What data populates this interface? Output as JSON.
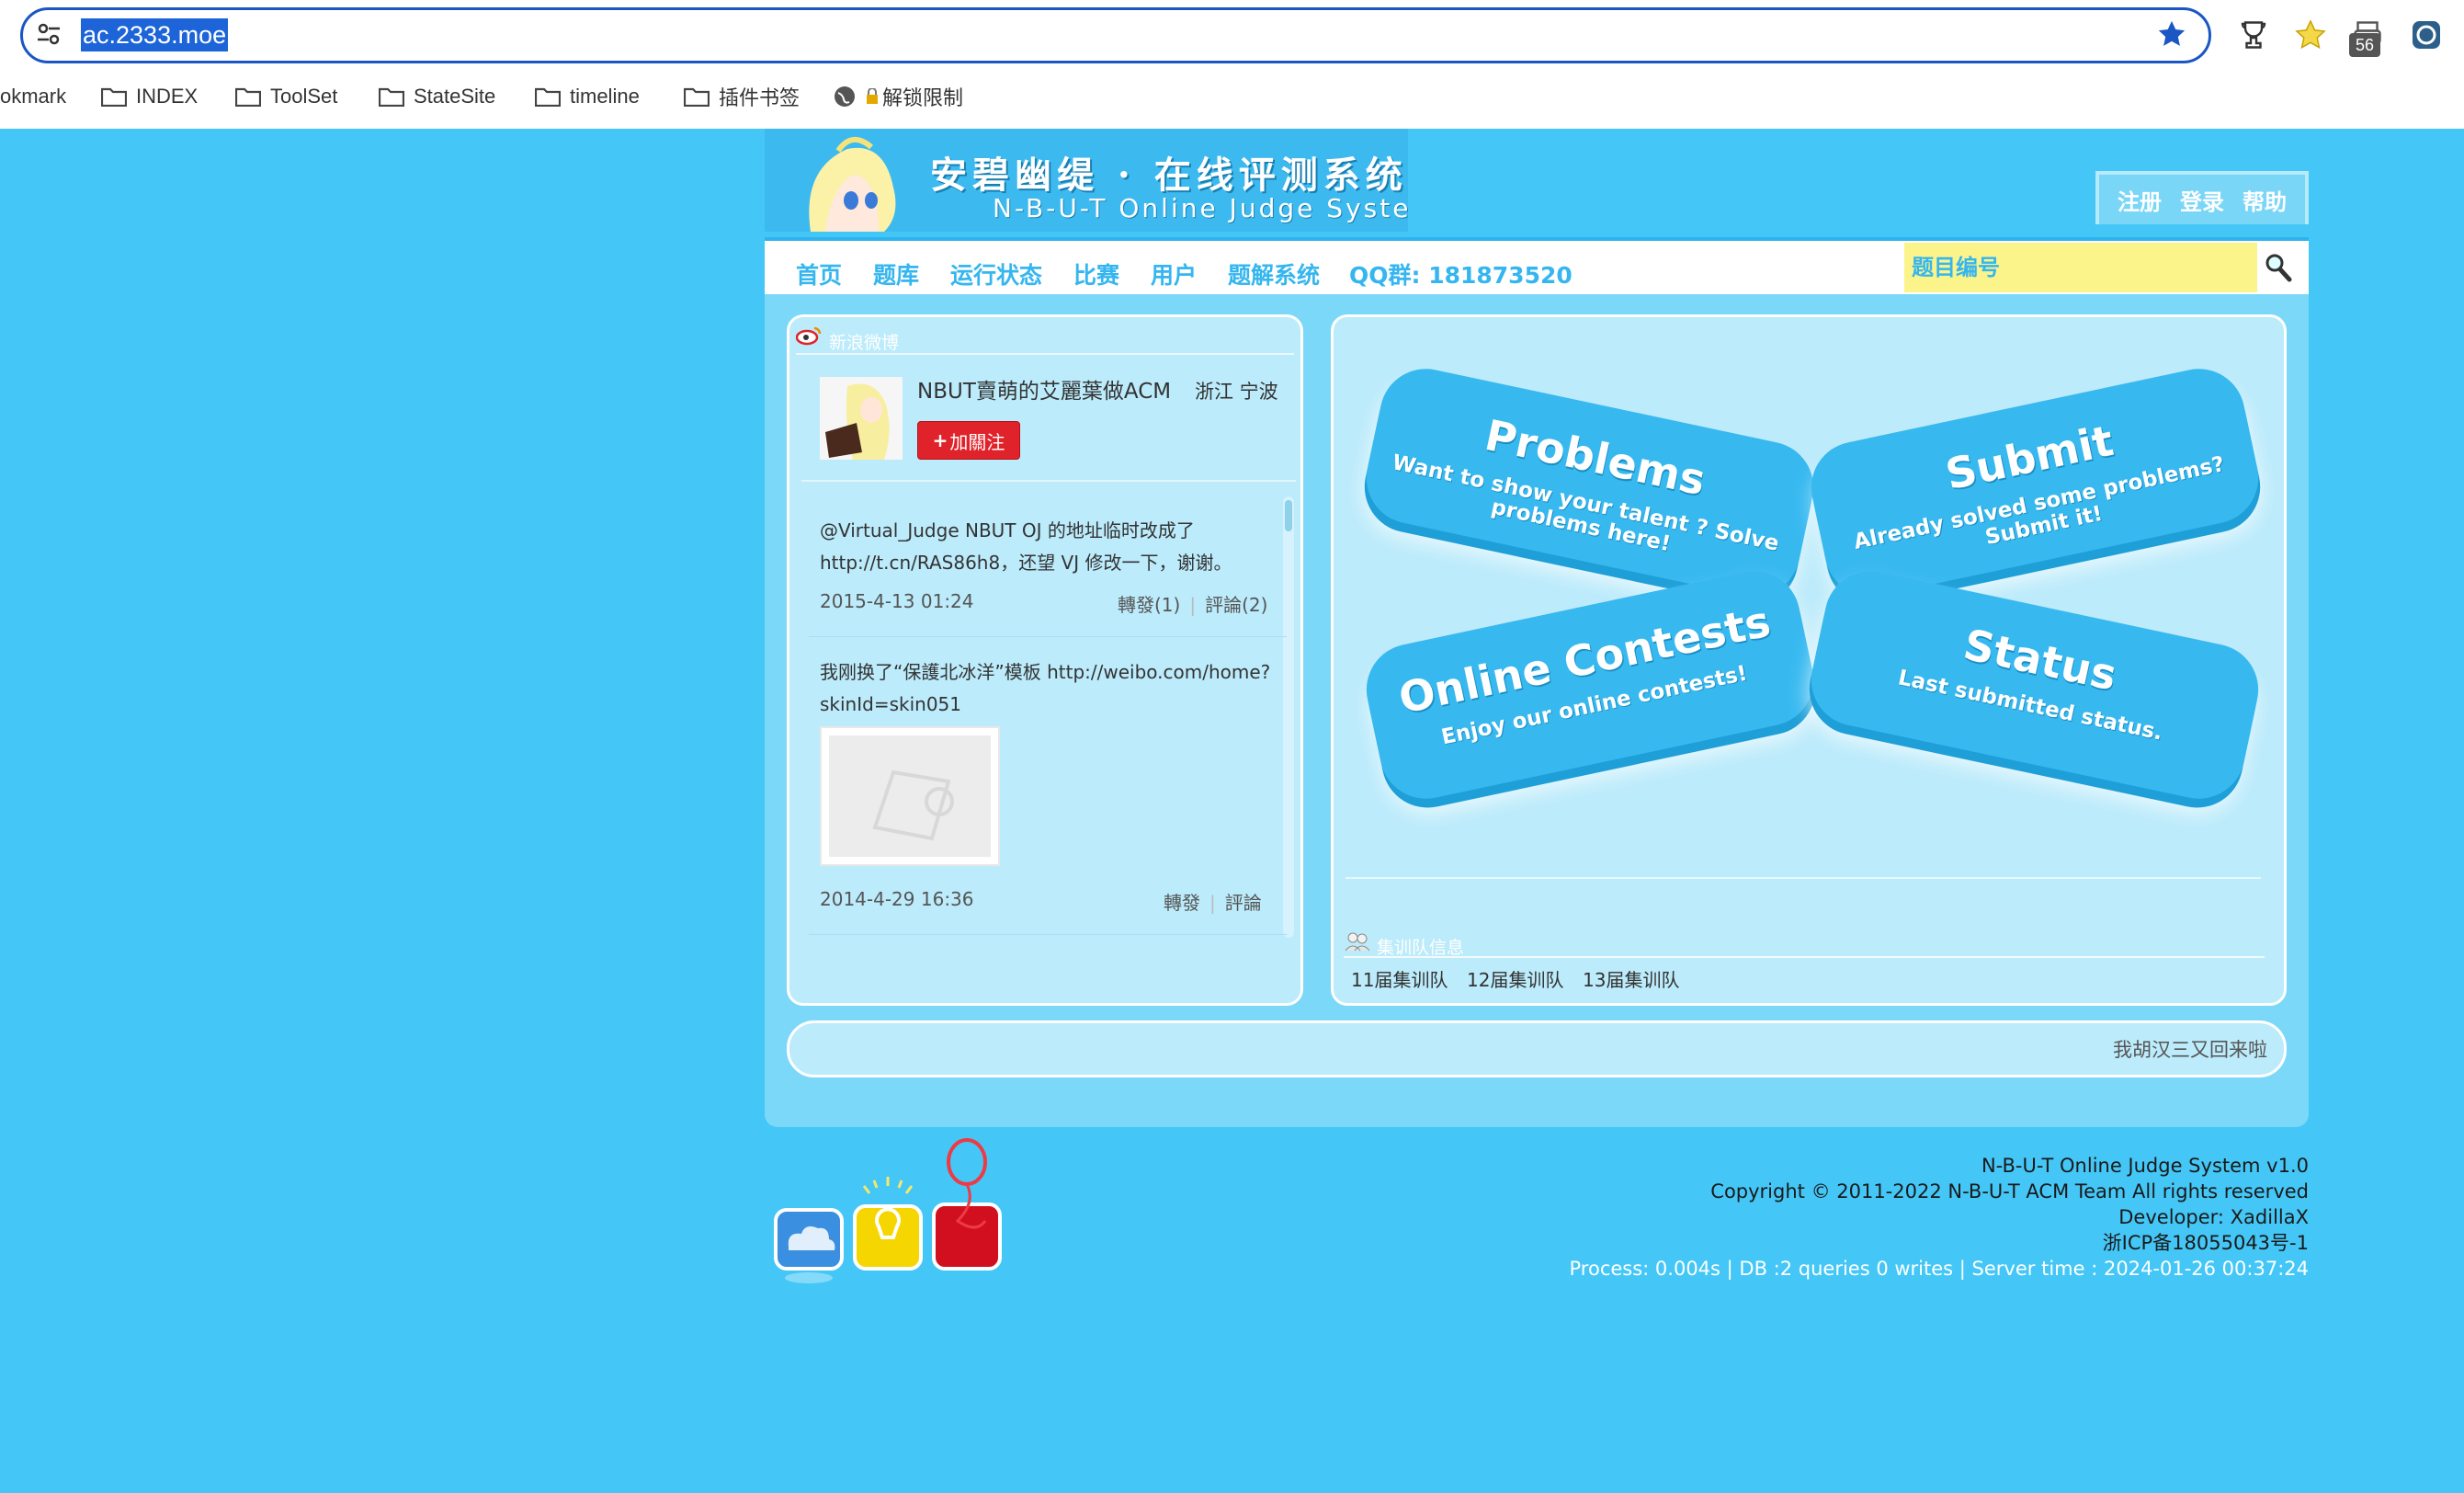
{
  "browser": {
    "url": "ac.2333.moe",
    "extension_badge": "56",
    "bookmarks": [
      {
        "label": "okmark",
        "icon": "none"
      },
      {
        "label": "INDEX",
        "icon": "folder-icon"
      },
      {
        "label": "ToolSet",
        "icon": "folder-icon"
      },
      {
        "label": "StateSite",
        "icon": "folder-icon"
      },
      {
        "label": "timeline",
        "icon": "folder-icon"
      },
      {
        "label": "插件书签",
        "icon": "folder-icon"
      },
      {
        "label": "解锁限制",
        "icon": "globe-icon"
      }
    ]
  },
  "site": {
    "banner_title": "安碧幽缇 · 在线评测系统",
    "banner_subtitle": "N-B-U-T Online Judge System",
    "top_links": [
      "注册",
      "登录",
      "帮助"
    ],
    "nav": [
      "首页",
      "题库",
      "运行状态",
      "比赛",
      "用户",
      "题解系统",
      "QQ群: 181873520"
    ],
    "search_placeholder": "题目编号"
  },
  "weibo": {
    "title": "新浪微博",
    "account_name": "NBUT賣萌的艾麗葉做ACM",
    "location": "浙江 宁波",
    "follow_label": "加關注",
    "posts": [
      {
        "text": "@Virtual_Judge NBUT OJ 的地址临时改成了 http://t.cn/RAS86h8，还望 VJ 修改一下，谢谢。",
        "date": "2015-4-13 01:24",
        "repost": "轉發(1)",
        "comment": "評論(2)"
      },
      {
        "text": "我刚换了“保護北冰洋”模板 http://weibo.com/home?skinId=skin051",
        "date": "2014-4-29 16:36",
        "repost": "轉發",
        "comment": "評論"
      }
    ]
  },
  "hub": {
    "cards": [
      {
        "title": "Problems",
        "subtitle": "Want to show your talent ? Solve problems here!"
      },
      {
        "title": "Submit",
        "subtitle": "Already solved some problems? Submit it!"
      },
      {
        "title": "Online Contests",
        "subtitle": "Enjoy our online contests!"
      },
      {
        "title": "Status",
        "subtitle": "Last submitted status."
      }
    ],
    "team_title": "集训队信息",
    "teams": [
      "11届集训队",
      "12届集训队",
      "13届集训队"
    ]
  },
  "message_bar": "我胡汉三又回来啦",
  "footer": {
    "line1": "N-B-U-T Online Judge System v1.0",
    "line2": "Copyright © 2011-2022 N-B-U-T ACM Team All rights reserved",
    "line3": "Developer: XadillaX",
    "line4": "浙ICP备18055043号-1",
    "line5": "Process: 0.004s | DB :2 queries 0 writes | Server time : 2024-01-26 00:37:24"
  },
  "colors": {
    "page_bg": "#44c7f7",
    "accent": "#35b6ef",
    "follow_button": "#e0232b",
    "search_bg": "#fbf48a"
  }
}
